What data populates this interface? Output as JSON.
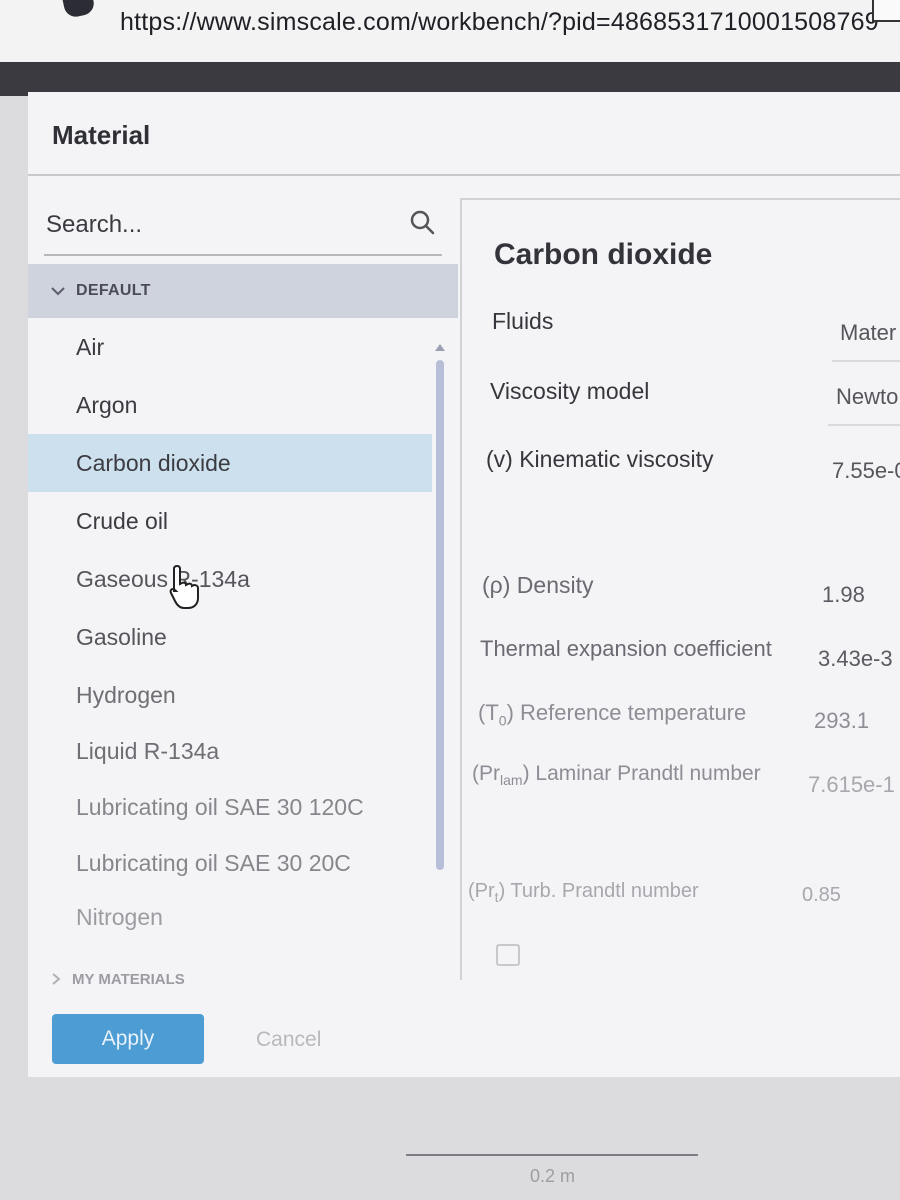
{
  "browser": {
    "url": "https://www.simscale.com/workbench/?pid=4868531710001508769"
  },
  "dialog": {
    "title": "Material",
    "search": {
      "placeholder": "Search..."
    },
    "default_group": {
      "label": "DEFAULT",
      "items": [
        {
          "label": "Air"
        },
        {
          "label": "Argon"
        },
        {
          "label": "Carbon dioxide",
          "selected": true
        },
        {
          "label": "Crude oil"
        },
        {
          "label": "Gaseous R-134a"
        },
        {
          "label": "Gasoline"
        },
        {
          "label": "Hydrogen"
        },
        {
          "label": "Liquid R-134a"
        },
        {
          "label": "Lubricating oil SAE 30 120C"
        },
        {
          "label": "Lubricating oil SAE 30 20C"
        },
        {
          "label": "Nitrogen"
        }
      ]
    },
    "my_materials_group": {
      "label": "MY MATERIALS"
    },
    "details": {
      "title": "Carbon dioxide",
      "fluids_label": "Fluids",
      "fluids_value": "Mater",
      "properties": [
        {
          "label": "Viscosity model",
          "value": "Newto"
        },
        {
          "prefix": "(v) ",
          "label": "Kinematic viscosity",
          "value": "7.55e-0"
        },
        {
          "prefix": "(ρ) ",
          "label": "Density",
          "value": "1.98"
        },
        {
          "label": "Thermal expansion coefficient",
          "value": "3.43e-3"
        },
        {
          "prefix": "(T",
          "sub": "0",
          "suffix": ") ",
          "label": "Reference temperature",
          "value": "293.1"
        },
        {
          "prefix": "(Pr",
          "sub": "lam",
          "suffix": ") ",
          "label": "Laminar Prandtl number",
          "value": "7.615e-1"
        },
        {
          "prefix": "(Pr",
          "sub": "t",
          "suffix": ") ",
          "label": "Turb. Prandtl number",
          "value": "0.85"
        }
      ]
    },
    "buttons": {
      "apply": "Apply",
      "cancel": "Cancel"
    }
  },
  "scale": {
    "label": "0.2 m"
  },
  "colors": {
    "accent": "#4d9cd3",
    "selected_row": "#cde0ee",
    "group_header": "#cfd3de"
  }
}
